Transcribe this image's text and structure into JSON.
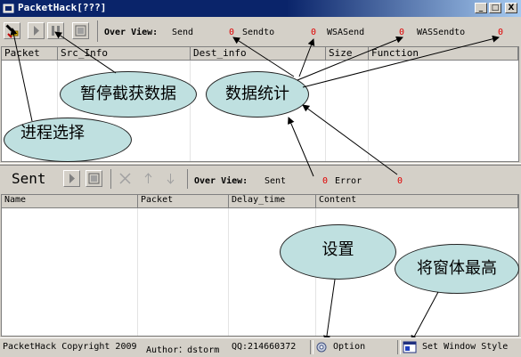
{
  "window": {
    "title": "PacketHack[???]"
  },
  "window_buttons": {
    "minimize": "_",
    "maximize": "□",
    "close": "X"
  },
  "top_toolbar": {
    "overview_label": "Over View:",
    "stats": [
      {
        "label": "Send",
        "value": "0"
      },
      {
        "label": "Sendto",
        "value": "0"
      },
      {
        "label": "WSASend",
        "value": "0"
      },
      {
        "label": "WASSendto",
        "value": "0"
      }
    ]
  },
  "packet_list": {
    "columns": [
      "Packet",
      "Src_Info",
      "Dest_info",
      "Size",
      "Function"
    ]
  },
  "sent_toolbar": {
    "title": "Sent",
    "overview_label": "Over View:",
    "stats": [
      {
        "label": "Sent",
        "value": "0"
      },
      {
        "label": "Error",
        "value": "0"
      }
    ]
  },
  "sent_list": {
    "columns": [
      "Name",
      "Packet",
      "Delay_time",
      "Content"
    ]
  },
  "annotations": {
    "pause": "暂停截获数据",
    "stats": "数据统计",
    "process": "进程选择",
    "settings": "设置",
    "topmost": "将窗体最高"
  },
  "statusbar": {
    "copyright": "PacketHack Copyright 2009",
    "author": "Author：dstorm",
    "qq": "QQ:214660372",
    "option": "Option",
    "window_style": "Set Window Style"
  },
  "colors": {
    "title_bar": "#0a246a",
    "stat_value": "#e00000",
    "bubble": "#bfe0e0",
    "face": "#d4d0c8"
  }
}
